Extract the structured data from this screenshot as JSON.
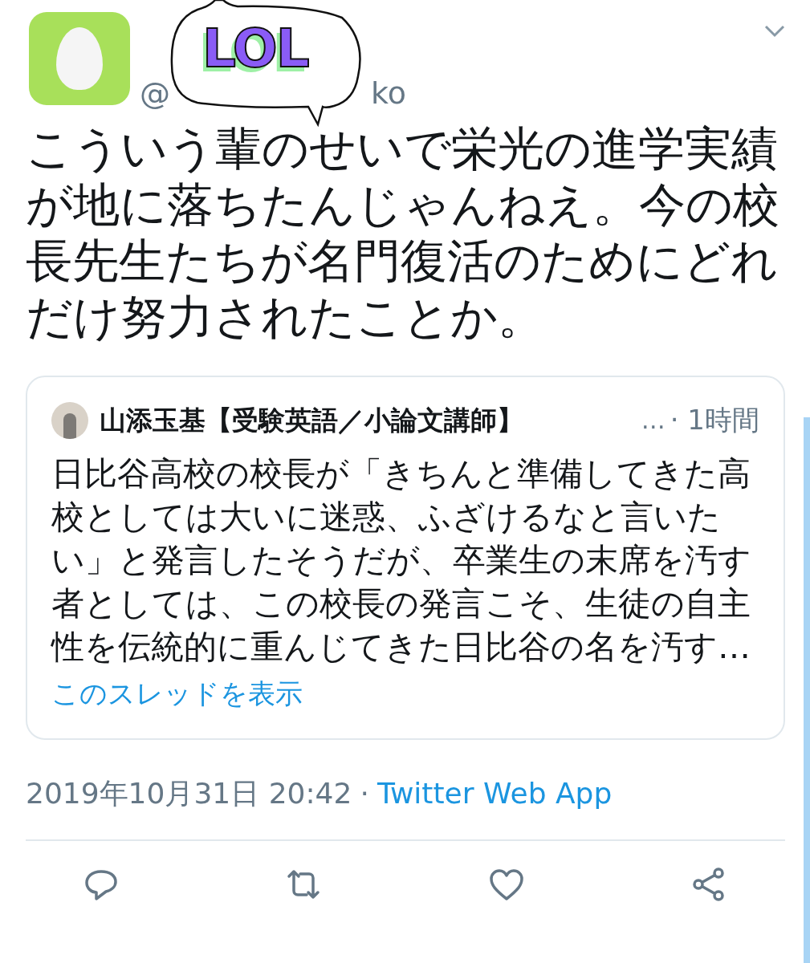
{
  "tweet": {
    "handle_start": "@",
    "handle_end": "ko",
    "sticker": {
      "text": "LOL"
    },
    "text": "こういう輩のせいで栄光の進学実績が地に落ちたんじゃんねえ。今の校長先生たちが名門復活のためにどれだけ努力されたことか。",
    "quote": {
      "author": "山添玉基【受験英語／小論文講師】",
      "more": "…",
      "time": "· 1時間",
      "text": "日比谷高校の校長が「きちんと準備してきた高校としては大いに迷惑、ふざけるなと言いたい」と発言したそうだが、卒業生の末席を汚す者としては、この校長の発言こそ、生徒の自主性を伝統的に重んじてきた日比谷の名を汚す…",
      "link": "このスレッドを表示"
    },
    "date": "2019年10月31日 20:42",
    "separator": "·",
    "source": "Twitter Web App"
  },
  "actions": [
    {
      "kind": "reply"
    },
    {
      "kind": "retweet"
    },
    {
      "kind": "like"
    },
    {
      "kind": "share"
    }
  ]
}
